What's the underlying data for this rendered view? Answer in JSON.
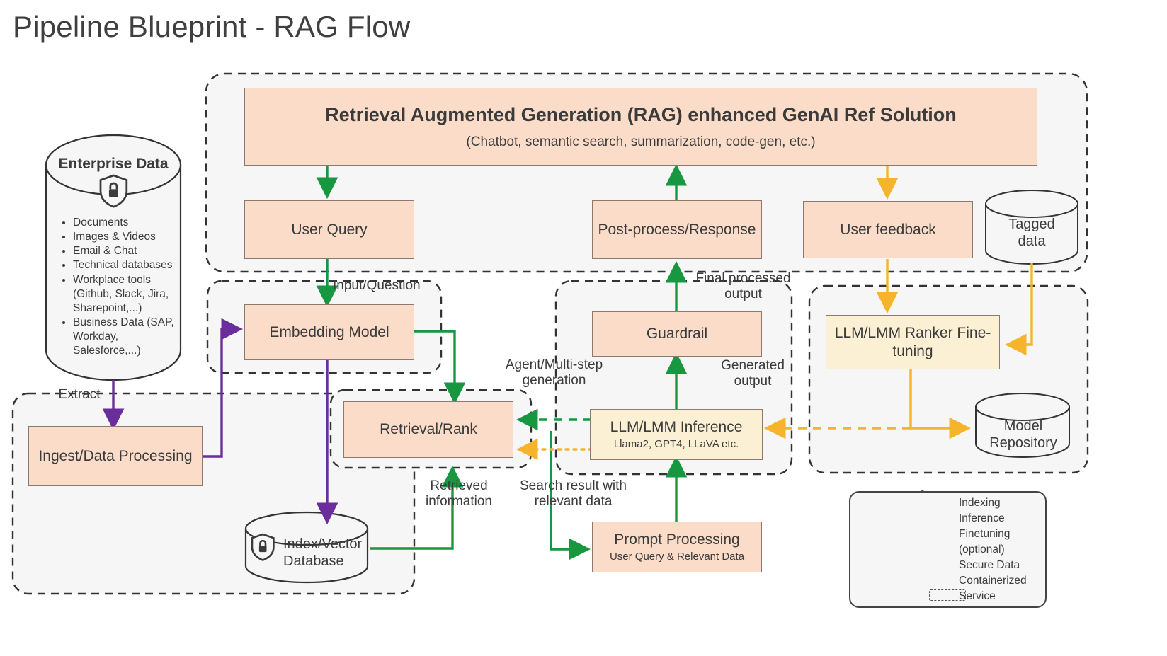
{
  "page": {
    "title": "Pipeline Blueprint - RAG Flow"
  },
  "colors": {
    "peach_fill": "#fadcc9",
    "cream_fill": "#fcf0d4",
    "box_stroke": "#8a7a72",
    "container_fill": "#f6f6f6",
    "container_stroke": "#333333",
    "indexing_purple": "#6a2d9b",
    "inference_green": "#17973f",
    "finetuning_orange": "#f6b32c",
    "text": "#3b3b3b"
  },
  "enterprise_data": {
    "title": "Enterprise Data",
    "icon": "shield-lock-icon",
    "items": [
      "Documents",
      "Images & Videos",
      "Email & Chat",
      "Technical databases",
      "Workplace tools (Github, Slack, Jira, Sharepoint,...)",
      "Business Data (SAP, Workday, Salesforce,...)"
    ]
  },
  "nodes": {
    "rag_solution": {
      "title": "Retrieval Augmented Generation (RAG) enhanced GenAI Ref Solution",
      "subtitle": "(Chatbot, semantic search, summarization, code-gen, etc.)"
    },
    "user_query": {
      "title": "User Query"
    },
    "post_process": {
      "title": "Post-process/Response"
    },
    "user_feedback": {
      "title": "User feedback"
    },
    "embedding_model": {
      "title": "Embedding Model"
    },
    "guardrail": {
      "title": "Guardrail"
    },
    "ranker_finetuning": {
      "title": "LLM/LMM Ranker Fine-tuning"
    },
    "retrieval_rank": {
      "title": "Retrieval/Rank"
    },
    "llm_inference": {
      "title": "LLM/LMM Inference",
      "subtitle": "Llama2, GPT4, LLaVA etc."
    },
    "ingest": {
      "title": "Ingest/Data Processing"
    },
    "prompt_processing": {
      "title": "Prompt Processing",
      "subtitle": "User Query & Relevant Data"
    }
  },
  "cylinders": {
    "tagged_data": {
      "label_line1": "Tagged",
      "label_line2": "data"
    },
    "model_repository": {
      "label_line1": "Model",
      "label_line2": "Repository"
    },
    "index_vector_db": {
      "label_line1": "Index/Vector",
      "label_line2": "Database",
      "icon": "shield-lock-icon"
    }
  },
  "edge_labels": {
    "extract": "Extract",
    "input_question": "Input/Question",
    "final_processed_output": "Final processed output",
    "generated_output": "Generated output",
    "agent_multistep": "Agent/Multi-step generation",
    "retrieved_information": "Retrieved information",
    "search_result": "Search result with relevant data"
  },
  "legend": {
    "entries": [
      {
        "kind": "arrow",
        "color": "#6a2d9b",
        "label": "Indexing"
      },
      {
        "kind": "arrow",
        "color": "#17973f",
        "label": "Inference"
      },
      {
        "kind": "arrow",
        "color": "#f6b32c",
        "label": "Finetuning (optional)"
      },
      {
        "kind": "icon",
        "icon": "shield-lock-icon",
        "label": "Secure Data"
      },
      {
        "kind": "dashed-box",
        "label": "Containerized Service"
      }
    ],
    "lines": [
      "Indexing",
      "Inference",
      "Finetuning",
      "(optional)",
      "Secure Data",
      "Containerized",
      "Service"
    ]
  }
}
